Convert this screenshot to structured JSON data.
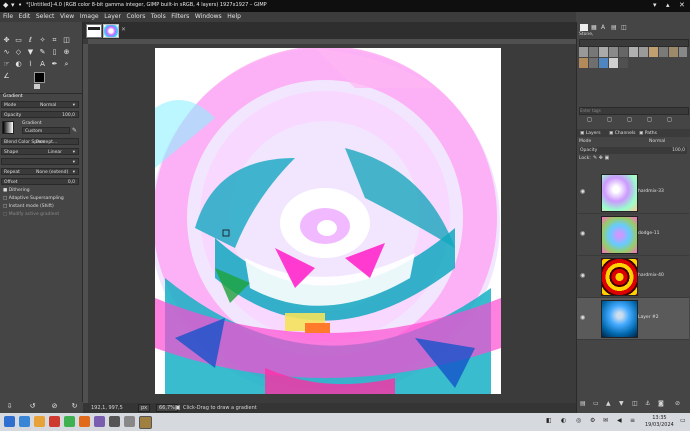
{
  "window": {
    "title": "*[Untitled]-4.0 (RGB color 8-bit gamma integer, GIMP built-in sRGB, 4 layers) 1927x1927 – GIMP"
  },
  "menu": [
    "File",
    "Edit",
    "Select",
    "View",
    "Image",
    "Layer",
    "Colors",
    "Tools",
    "Filters",
    "Windows",
    "Help"
  ],
  "tool_options": {
    "header": "Gradient",
    "mode_label": "Mode",
    "mode_value": "Normal",
    "opacity_label": "Opacity",
    "opacity_value": "100,0",
    "gradient_label": "Gradient",
    "gradient_value": "Custom",
    "blend_space_label": "Blend Color Space",
    "blend_space_value": "Percept...",
    "shape_label": "Shape",
    "shape_value": "Linear",
    "repeat_label": "Repeat",
    "repeat_value": "None (extend)",
    "offset_label": "Offset",
    "offset_value": "0,0",
    "dithering": "Dithering",
    "adaptive": "Adaptive Supersampling",
    "instant": "Instant mode (Shift)",
    "modify": "Modify active gradient"
  },
  "statusbar": {
    "coords": "192,1, 997,5",
    "unit": "px",
    "zoom": "66,7%",
    "message": "Click-Drag to draw a gradient"
  },
  "brushes": {
    "name": "Stone,",
    "filter_placeholder": "Enter tags"
  },
  "layers_panel": {
    "tabs": [
      "Layers",
      "Channels",
      "Paths"
    ],
    "mode_label": "Mode",
    "mode_value": "Normal",
    "opacity_label": "Opacity",
    "opacity_value": "100,0",
    "lock_label": "Lock:",
    "layers": [
      {
        "name": "hardmix-33",
        "selected": false
      },
      {
        "name": "dodge-11",
        "selected": false
      },
      {
        "name": "hardmix-40",
        "selected": false
      },
      {
        "name": "Layer #2",
        "selected": true
      }
    ]
  },
  "taskbar": {
    "time": "13:35",
    "date": "19/03/2024"
  },
  "colors": {
    "title_bg": "#0f0f0f",
    "panel_bg": "#454545",
    "selected_layer": "#5a5a5a",
    "taskbar_bg": "#d6d9de"
  }
}
